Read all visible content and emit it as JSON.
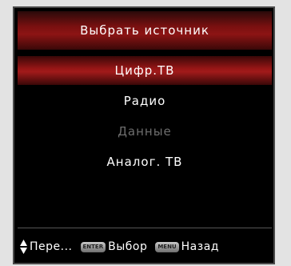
{
  "dialog": {
    "title": "Выбрать источник"
  },
  "menu": {
    "items": [
      {
        "label": "Цифр.ТВ",
        "state": "selected"
      },
      {
        "label": "Радио",
        "state": "normal"
      },
      {
        "label": "Данные",
        "state": "disabled"
      },
      {
        "label": "Аналог. ТВ",
        "state": "normal"
      }
    ]
  },
  "footer": {
    "navigate_label": "Пере...",
    "enter_key": "ENTER",
    "select_label": "Выбор",
    "menu_key": "MENU",
    "back_label": "Назад"
  },
  "colors": {
    "accent": "#8c1414",
    "background": "#000000",
    "text": "#ffffff",
    "disabled_text": "#6e6e6e"
  }
}
